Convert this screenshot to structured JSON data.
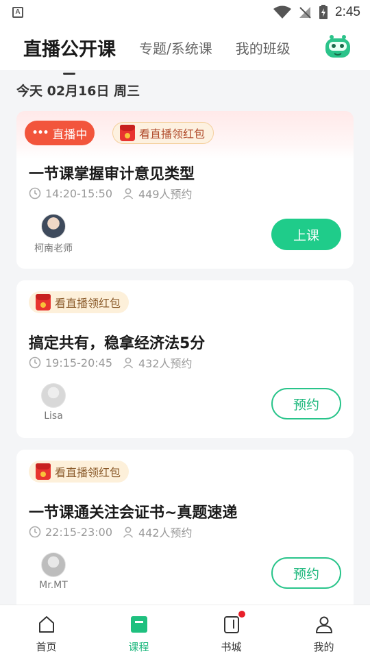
{
  "status_bar": {
    "time": "2:45",
    "app_icon_letter": "A"
  },
  "header": {
    "tabs": [
      {
        "label": "直播公开课",
        "active": true
      },
      {
        "label": "专题/系统课",
        "active": false
      },
      {
        "label": "我的班级",
        "active": false
      }
    ]
  },
  "date_label": "今天 02月16日 周三",
  "courses": [
    {
      "live_badge": "直播中",
      "redpack": "看直播领红包",
      "title": "一节课掌握审计意见类型",
      "time": "14:20-15:50",
      "reservations": "449人预约",
      "teacher": "柯南老师",
      "button": "上课"
    },
    {
      "redpack": "看直播领红包",
      "title": "搞定共有，稳拿经济法5分",
      "time": "19:15-20:45",
      "reservations": "432人预约",
      "teacher": "Lisa",
      "button": "预约"
    },
    {
      "redpack": "看直播领红包",
      "title": "一节课通关注会证书~真题速递",
      "time": "22:15-23:00",
      "reservations": "442人预约",
      "teacher": "Mr.MT",
      "button": "预约"
    }
  ],
  "bottom_nav": [
    {
      "label": "首页",
      "icon": "home-icon"
    },
    {
      "label": "课程",
      "icon": "course-icon",
      "active": true
    },
    {
      "label": "书城",
      "icon": "bookstore-icon",
      "has_badge": true
    },
    {
      "label": "我的",
      "icon": "profile-icon"
    }
  ],
  "colors": {
    "accent": "#1fcc8a",
    "live": "#f2553c",
    "badge_dot": "#e8202a"
  }
}
